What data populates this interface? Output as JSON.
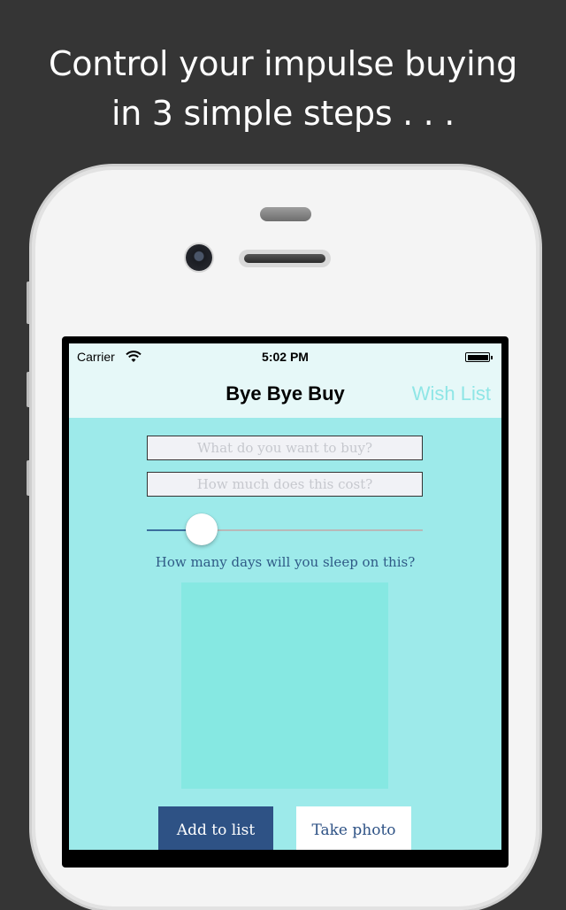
{
  "headline": {
    "line1": "Control your impulse buying",
    "line2": "in 3 simple steps . . ."
  },
  "status_bar": {
    "carrier": "Carrier",
    "time": "5:02 PM",
    "icons": [
      "wifi-icon",
      "battery-icon"
    ]
  },
  "nav": {
    "title": "Bye Bye Buy",
    "right_button": "Wish List"
  },
  "form": {
    "item_placeholder": "What do you want to buy?",
    "cost_placeholder": "How much does this cost?",
    "slider_caption": "How many days will you sleep on this?",
    "slider_value_fraction": 0.16
  },
  "buttons": {
    "add": "Add to list",
    "photo": "Take photo"
  },
  "colors": {
    "background": "#353535",
    "screen": "#9deaea",
    "photo_area": "#86e8e2",
    "accent_blue": "#2e5285",
    "nav_link": "#8fe6e6"
  }
}
